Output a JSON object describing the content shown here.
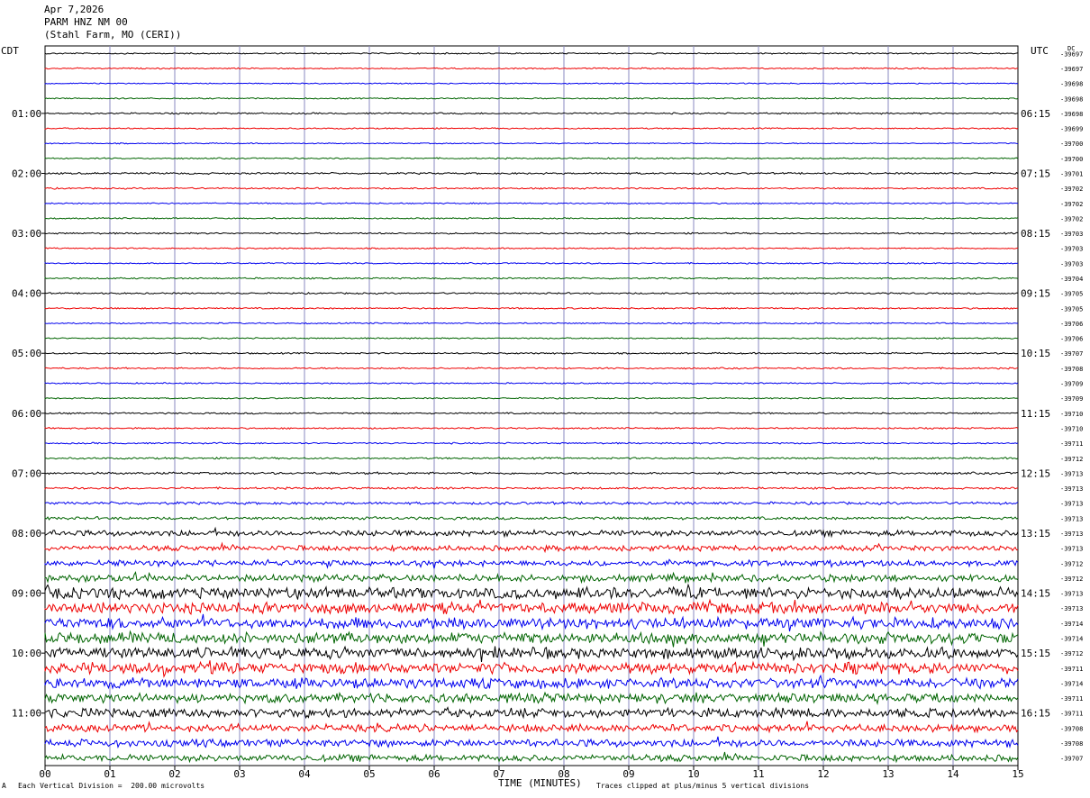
{
  "header": {
    "date": "Apr 7,2026",
    "station": "PARM HNZ NM 00",
    "location": "(Stahl Farm, MO (CERI))"
  },
  "left_tz": "CDT",
  "right_tz": "UTC",
  "dc_label": "DC",
  "footer": {
    "scale_note": "Each Vertical Division =  200.00 microvolts",
    "xlabel": "TIME (MINUTES)",
    "clip_note": "Traces clipped at plus/minus 5 vertical divisions",
    "corner_mark": "A"
  },
  "chart_data": {
    "type": "line",
    "title": "PARM HNZ NM 00",
    "xlabel": "TIME (MINUTES)",
    "x_ticks": [
      "00",
      "01",
      "02",
      "03",
      "04",
      "05",
      "06",
      "07",
      "08",
      "09",
      "10",
      "11",
      "12",
      "13",
      "14",
      "15"
    ],
    "xlim": [
      0,
      15
    ],
    "grid": true,
    "trace_colors": [
      "#000000",
      "#ee0000",
      "#0000ee",
      "#006400"
    ],
    "left_hour_labels": [
      {
        "row": 4,
        "label": "01:00"
      },
      {
        "row": 8,
        "label": "02:00"
      },
      {
        "row": 12,
        "label": "03:00"
      },
      {
        "row": 16,
        "label": "04:00"
      },
      {
        "row": 20,
        "label": "05:00"
      },
      {
        "row": 24,
        "label": "06:00"
      },
      {
        "row": 28,
        "label": "07:00"
      },
      {
        "row": 32,
        "label": "08:00"
      },
      {
        "row": 36,
        "label": "09:00"
      },
      {
        "row": 40,
        "label": "10:00"
      },
      {
        "row": 44,
        "label": "11:00"
      }
    ],
    "right_hour_labels": [
      {
        "row": 4,
        "label": "06:15"
      },
      {
        "row": 8,
        "label": "07:15"
      },
      {
        "row": 12,
        "label": "08:15"
      },
      {
        "row": 16,
        "label": "09:15"
      },
      {
        "row": 20,
        "label": "10:15"
      },
      {
        "row": 24,
        "label": "11:15"
      },
      {
        "row": 28,
        "label": "12:15"
      },
      {
        "row": 32,
        "label": "13:15"
      },
      {
        "row": 36,
        "label": "14:15"
      },
      {
        "row": 40,
        "label": "15:15"
      },
      {
        "row": 44,
        "label": "16:15"
      }
    ],
    "dc_offsets": [
      "-39697",
      "-39697",
      "-39698",
      "-39698",
      "-39698",
      "-39699",
      "-39700",
      "-39700",
      "-39701",
      "-39702",
      "-39702",
      "-39702",
      "-39703",
      "-39703",
      "-39703",
      "-39704",
      "-39705",
      "-39705",
      "-39706",
      "-39706",
      "-39707",
      "-39708",
      "-39709",
      "-39709",
      "-39710",
      "-39710",
      "-39711",
      "-39712",
      "-39713",
      "-39713",
      "-39713",
      "-39713",
      "-39713",
      "-39713",
      "-39712",
      "-39712",
      "-39713",
      "-39713",
      "-39714",
      "-39714",
      "-39712",
      "-39711",
      "-39714",
      "-39711",
      "-39711",
      "-39708",
      "-39708",
      "-39707"
    ],
    "trace_amplitude": [
      0.6,
      0.6,
      0.5,
      0.6,
      0.7,
      0.6,
      0.5,
      0.6,
      0.8,
      0.7,
      0.6,
      0.6,
      0.7,
      0.6,
      0.6,
      0.7,
      0.7,
      0.7,
      0.6,
      0.6,
      0.7,
      0.7,
      0.6,
      0.6,
      0.7,
      0.7,
      0.7,
      0.8,
      1.0,
      0.9,
      1.2,
      1.3,
      2.6,
      2.4,
      2.6,
      3.2,
      5.0,
      5.0,
      5.0,
      5.0,
      5.0,
      5.0,
      4.6,
      4.2,
      4.2,
      3.4,
      3.4,
      3.0
    ]
  }
}
